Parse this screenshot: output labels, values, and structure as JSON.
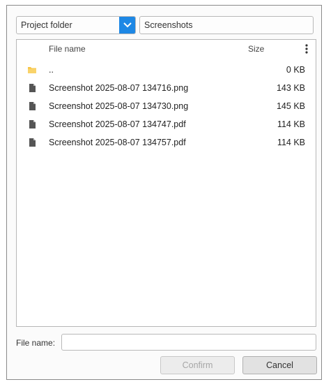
{
  "toolbar": {
    "location_select": "Project folder",
    "current_path": "Screenshots"
  },
  "file_list": {
    "columns": {
      "name": "File name",
      "size": "Size"
    },
    "rows": [
      {
        "icon": "folder-icon",
        "name": "..",
        "size": "0 KB"
      },
      {
        "icon": "file-icon",
        "name": "Screenshot 2025-08-07 134716.png",
        "size": "143 KB"
      },
      {
        "icon": "file-icon",
        "name": "Screenshot 2025-08-07 134730.png",
        "size": "145 KB"
      },
      {
        "icon": "file-icon",
        "name": "Screenshot 2025-08-07 134747.pdf",
        "size": "114 KB"
      },
      {
        "icon": "file-icon",
        "name": "Screenshot 2025-08-07 134757.pdf",
        "size": "114 KB"
      }
    ]
  },
  "footer": {
    "file_name_label": "File name:",
    "file_name_value": "",
    "confirm_label": "Confirm",
    "cancel_label": "Cancel"
  },
  "colors": {
    "accent": "#1e88e5",
    "folder": "#f6c445",
    "file_icon": "#555555"
  }
}
